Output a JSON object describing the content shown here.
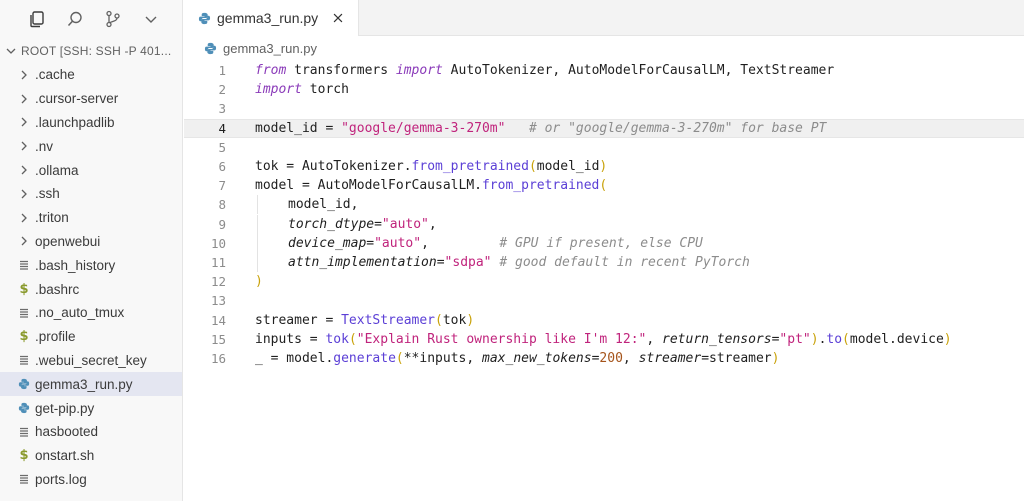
{
  "sidebar": {
    "root_label": "ROOT [SSH: SSH -P 401...",
    "items": [
      {
        "label": ".cache",
        "kind": "folder"
      },
      {
        "label": ".cursor-server",
        "kind": "folder"
      },
      {
        "label": ".launchpadlib",
        "kind": "folder"
      },
      {
        "label": ".nv",
        "kind": "folder"
      },
      {
        "label": ".ollama",
        "kind": "folder"
      },
      {
        "label": ".ssh",
        "kind": "folder"
      },
      {
        "label": ".triton",
        "kind": "folder"
      },
      {
        "label": "openwebui",
        "kind": "folder"
      },
      {
        "label": ".bash_history",
        "kind": "text"
      },
      {
        "label": ".bashrc",
        "kind": "shell"
      },
      {
        "label": ".no_auto_tmux",
        "kind": "text"
      },
      {
        "label": ".profile",
        "kind": "shell"
      },
      {
        "label": ".webui_secret_key",
        "kind": "text"
      },
      {
        "label": "gemma3_run.py",
        "kind": "python",
        "active": true
      },
      {
        "label": "get-pip.py",
        "kind": "python"
      },
      {
        "label": "hasbooted",
        "kind": "text"
      },
      {
        "label": "onstart.sh",
        "kind": "shell"
      },
      {
        "label": "ports.log",
        "kind": "text"
      }
    ]
  },
  "tab": {
    "label": "gemma3_run.py"
  },
  "breadcrumb": {
    "file": "gemma3_run.py"
  },
  "editor": {
    "current_line": 4,
    "line_numbers": [
      "1",
      "2",
      "3",
      "4",
      "5",
      "6",
      "7",
      "8",
      "9",
      "10",
      "11",
      "12",
      "13",
      "14",
      "15",
      "16"
    ]
  },
  "colors": {
    "accent": "#e4e6f1",
    "keyword": "#8a3ab9",
    "string": "#c0237c",
    "comment": "#8c8c8c",
    "function": "#5b3fd6"
  }
}
